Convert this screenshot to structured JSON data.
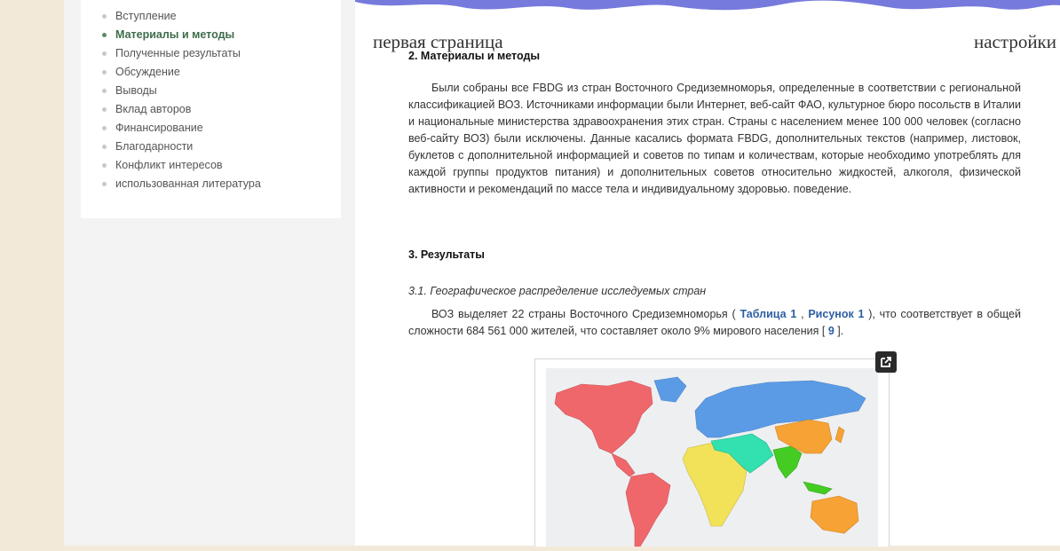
{
  "toc": {
    "items": [
      {
        "label": "Вступление",
        "active": false
      },
      {
        "label": "Материалы и методы",
        "active": true
      },
      {
        "label": "Полученные результаты",
        "active": false
      },
      {
        "label": "Обсуждение",
        "active": false
      },
      {
        "label": "Выводы",
        "active": false
      },
      {
        "label": "Вклад авторов",
        "active": false
      },
      {
        "label": "Финансирование",
        "active": false
      },
      {
        "label": "Благодарности",
        "active": false
      },
      {
        "label": "Конфликт интересов",
        "active": false
      },
      {
        "label": "использованная литература",
        "active": false
      }
    ]
  },
  "overlay": {
    "left": "первая страница",
    "right": "настройки"
  },
  "article": {
    "section2_title": "2. Материалы и методы",
    "section2_text": "Были собраны все FBDG из стран Восточного Средиземноморья, определенные в соответствии с региональной классификацией ВОЗ. Источниками информации были Интернет, веб-сайт ФАО, культурное бюро посольств в Италии и национальные министерства здравоохранения этих стран. Страны с населением менее 100 000 человек (согласно веб-сайту ВОЗ) были исключены. Данные касались формата FBDG, дополнительных текстов (например, листовок, буклетов с дополнительной информацией и советов по типам и количествам, которые необходимо употреблять для каждой группы продуктов питания) и дополнительных советов относительно жидкостей, алкоголя, физической активности и рекомендаций по массе тела и индивидуальному здоровью. поведение.",
    "section3_title": "3. Результаты",
    "subsection_title": "3.1. Географическое распределение исследуемых стран",
    "para3_before": "ВОЗ выделяет 22 страны Восточного Средиземноморья ( ",
    "link_table": "Таблица 1",
    "para3_sep": " , ",
    "link_figure": "Рисунок 1",
    "para3_mid": " ), что соответствует в общей сложности 684 561 000 жителей, что составляет около 9% мирового населения [ ",
    "link_ref": "9",
    "para3_end": " ]."
  },
  "colors": {
    "toc_active": "#3f6c4b",
    "link": "#2c5ea3",
    "map_americas": "#f0676b",
    "map_europe": "#5b9be6",
    "map_africa": "#f2e25a",
    "map_emr": "#32e0b0",
    "map_searo": "#44cc22",
    "map_wpro": "#f7a234"
  }
}
